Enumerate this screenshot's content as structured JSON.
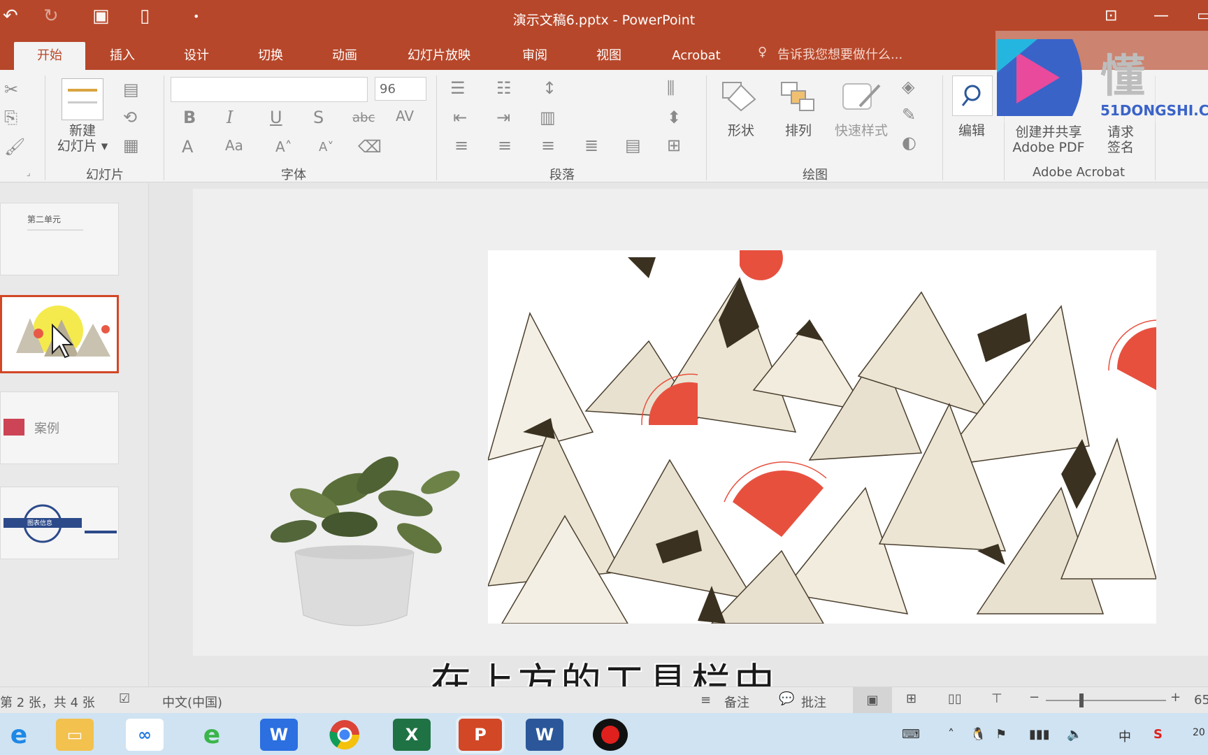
{
  "window": {
    "title": "演示文稿6.pptx - PowerPoint",
    "quick_access": [
      "undo-icon",
      "redo-icon",
      "present-icon",
      "new-icon",
      "customize-icon"
    ]
  },
  "tabs": [
    "开始",
    "插入",
    "设计",
    "切换",
    "动画",
    "幻灯片放映",
    "审阅",
    "视图",
    "Acrobat"
  ],
  "tell_me": "告诉我您想要做什么...",
  "ribbon": {
    "font_name_value": "",
    "font_size_value": "96",
    "new_slide_label_1": "新建",
    "new_slide_label_2": "幻灯片",
    "shape_label": "形状",
    "arrange_label": "排列",
    "quick_style_label": "快速样式",
    "edit_label": "编辑",
    "create_share_1": "创建并共享",
    "create_share_2": "Adobe PDF",
    "request_sign_1": "请求",
    "request_sign_2": "签名",
    "groups": {
      "slides": "幻灯片",
      "font": "字体",
      "paragraph": "段落",
      "drawing": "绘图",
      "acrobat": "Adobe Acrobat"
    }
  },
  "watermark": {
    "brand_text": "懂",
    "site": "51DONGSHI.C"
  },
  "thumbnails": [
    {
      "title": "第二单元"
    },
    {
      "title": ""
    },
    {
      "title": "案例"
    },
    {
      "title": "图表信息"
    }
  ],
  "caption": "在上方的工具栏中",
  "status": {
    "slide_info": "第 2 张，共 4 张",
    "language": "中文(中国)",
    "notes": "备注",
    "comments": "批注",
    "zoom": "65"
  },
  "taskbar": {
    "apps": [
      "ie",
      "explorer",
      "baidu-netdisk",
      "browser-360",
      "wps",
      "chrome",
      "excel",
      "powerpoint",
      "word",
      "recorder"
    ],
    "tray_ime": "中",
    "clock": "20"
  },
  "colors": {
    "accent": "#b7472a",
    "selected_thumb": "#d24726"
  }
}
